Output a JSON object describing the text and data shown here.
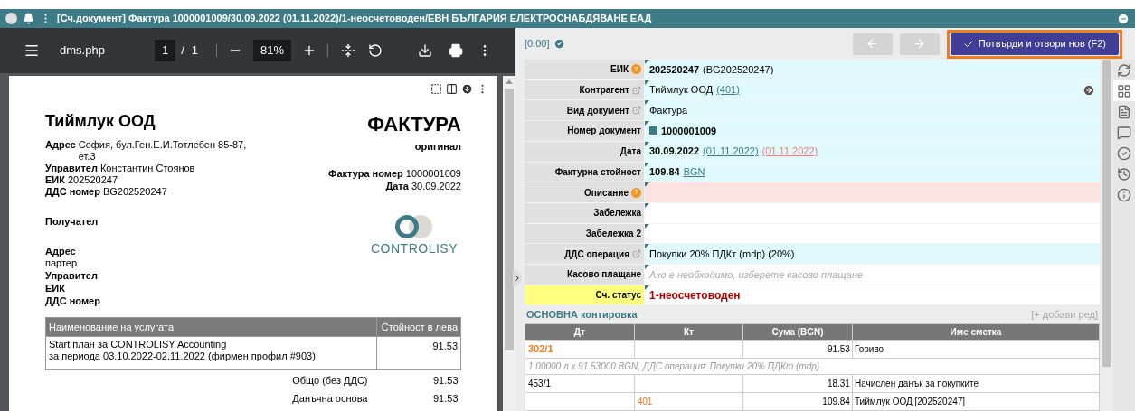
{
  "window": {
    "title": "[Сч.документ] Фактура 1000001009/30.09.2022 (01.11.2022)/1-неосчетоводен/ЕВН БЪЛГАРИЯ ЕЛЕКТРОСНАБДЯВАНЕ ЕАД"
  },
  "pdf_viewer": {
    "file_name": "dms.php",
    "page": "1",
    "page_separator": "/",
    "page_count": "1",
    "zoom": "81%"
  },
  "invoice": {
    "seller": "Тиймлук ООД",
    "doc_title": "ФАКТУРА",
    "copy": "оригинал",
    "seller_lines": [
      {
        "label": "Адрес",
        "value": "София, бул.Ген.Е.И.Тотлебен 85-87, ет.3"
      },
      {
        "label": "Управител",
        "value": "Константин Стоянов"
      },
      {
        "label": "ЕИК",
        "value": "202520247"
      },
      {
        "label": "ДДС номер",
        "value": "BG202520247"
      }
    ],
    "meta_lines": [
      {
        "label": "Фактура номер",
        "value": "1000001009"
      },
      {
        "label": "Дата",
        "value": "30.09.2022"
      }
    ],
    "recipient_title": "Получател",
    "recipient_lines": [
      {
        "label": "Адрес",
        "value": "партер"
      },
      {
        "label": "Управител"
      },
      {
        "label": "ЕИК"
      },
      {
        "label": "ДДС номер"
      }
    ],
    "logo_text": "CONTROLISY",
    "table": {
      "columns": [
        "Наименование на услугата",
        "Стойност в лева"
      ],
      "rows": [
        {
          "lines": [
            "Start план за CONTROLISY Accounting",
            "за периода 03.10.2022-02.11.2022 (фирмен профил #903)"
          ],
          "value": "91.53"
        }
      ]
    },
    "totals": [
      {
        "label": "Общо (без ДДС)",
        "value": "91.53"
      },
      {
        "label": "Данъчна основа",
        "value": "91.53"
      }
    ]
  },
  "form": {
    "balance": "[0.00]",
    "confirm_button": "Потвърди и отвори нов (F2)",
    "fields": [
      {
        "label": "ЕИК",
        "help_mark": "?",
        "kind": "filled",
        "parts": [
          {
            "kind": "bold",
            "text": "202520247"
          },
          {
            "kind": "plain",
            "text": "(BG202520247)"
          }
        ]
      },
      {
        "label": "Контрагент",
        "external_link": true,
        "kind": "filled",
        "go_icon": true,
        "parts": [
          {
            "kind": "plain",
            "text": "Тиймлук ООД"
          },
          {
            "kind": "link",
            "text": "(401)"
          }
        ]
      },
      {
        "label": "Вид документ",
        "external_link": true,
        "kind": "filled",
        "parts": [
          {
            "kind": "plain",
            "text": "Фактура"
          }
        ]
      },
      {
        "label": "Номер документ",
        "kind": "filled",
        "parts": [
          {
            "kind": "square"
          },
          {
            "kind": "bold",
            "text": "1000001009"
          }
        ]
      },
      {
        "label": "Дата",
        "kind": "filled",
        "parts": [
          {
            "kind": "bold",
            "text": "30.09.2022"
          },
          {
            "kind": "link",
            "text": "(01.11.2022)"
          },
          {
            "kind": "link_red",
            "text": "(01.11.2022)"
          }
        ]
      },
      {
        "label": "Фактурна стойност",
        "kind": "filled",
        "parts": [
          {
            "kind": "bold",
            "text": "109.84"
          },
          {
            "kind": "link",
            "text": "BGN"
          }
        ]
      },
      {
        "label": "Описание",
        "help_mark": "?",
        "kind": "required"
      },
      {
        "label": "Забележка",
        "kind": "blank"
      },
      {
        "label": "Забележка 2",
        "kind": "blank"
      },
      {
        "label": "ДДС операция",
        "external_link": true,
        "kind": "filled",
        "parts": [
          {
            "kind": "plain",
            "text": "Покупки 20% ПДКт (mdp) (20%)"
          }
        ]
      },
      {
        "label": "Касово плащане",
        "kind": "blank",
        "parts": [
          {
            "kind": "placeholder",
            "text": "Ако е необходимо, изберете касово плащане"
          }
        ]
      },
      {
        "label": "Сч. статус",
        "kind": "blank",
        "highlighted": true,
        "parts": [
          {
            "kind": "status",
            "text": "1-неосчетоводен"
          }
        ]
      }
    ],
    "posting": {
      "title": "ОСНОВНА контировка",
      "add_row": "[+ добави ред]",
      "columns": [
        "Дт",
        "Кт",
        "Сума (BGN)",
        "Име сметка"
      ],
      "rows": [
        {
          "kind": "entry",
          "dt": {
            "text": "302/1",
            "accent": true
          },
          "amount": "91.53",
          "account": "Гориво"
        },
        {
          "kind": "note",
          "text": "1.00000 л x 91.53000 BGN, ДДС операция: Покупки 20% ПДКт (mdp)"
        },
        {
          "kind": "entry",
          "dt": {
            "text": "453/1",
            "accent": false
          },
          "amount": "18.31",
          "account": "Начислен данък за покупките"
        },
        {
          "kind": "entry",
          "kt": {
            "text": "401",
            "accent": true
          },
          "amount": "109.84",
          "account": "Тиймлук ООД [202520247]"
        }
      ]
    }
  },
  "side_tools": [
    {
      "kind": "sync",
      "selected": false
    },
    {
      "kind": "grid",
      "selected": true
    },
    {
      "kind": "attachment",
      "selected": false
    },
    {
      "kind": "comment",
      "selected": false
    },
    {
      "kind": "check",
      "selected": false
    },
    {
      "kind": "history",
      "selected": false
    },
    {
      "kind": "info",
      "selected": false
    }
  ]
}
